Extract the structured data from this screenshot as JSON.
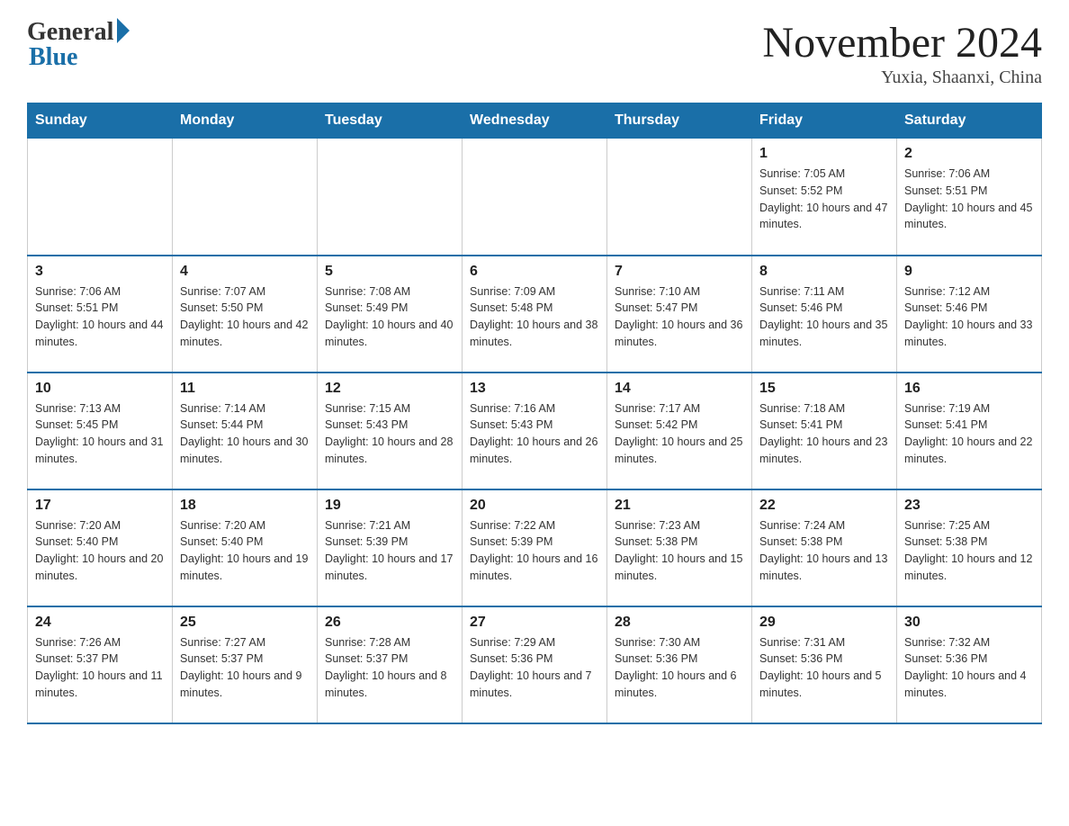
{
  "logo": {
    "general": "General",
    "blue": "Blue"
  },
  "title": {
    "month_year": "November 2024",
    "location": "Yuxia, Shaanxi, China"
  },
  "days_of_week": [
    "Sunday",
    "Monday",
    "Tuesday",
    "Wednesday",
    "Thursday",
    "Friday",
    "Saturday"
  ],
  "weeks": [
    [
      {
        "day": "",
        "info": ""
      },
      {
        "day": "",
        "info": ""
      },
      {
        "day": "",
        "info": ""
      },
      {
        "day": "",
        "info": ""
      },
      {
        "day": "",
        "info": ""
      },
      {
        "day": "1",
        "info": "Sunrise: 7:05 AM\nSunset: 5:52 PM\nDaylight: 10 hours and 47 minutes."
      },
      {
        "day": "2",
        "info": "Sunrise: 7:06 AM\nSunset: 5:51 PM\nDaylight: 10 hours and 45 minutes."
      }
    ],
    [
      {
        "day": "3",
        "info": "Sunrise: 7:06 AM\nSunset: 5:51 PM\nDaylight: 10 hours and 44 minutes."
      },
      {
        "day": "4",
        "info": "Sunrise: 7:07 AM\nSunset: 5:50 PM\nDaylight: 10 hours and 42 minutes."
      },
      {
        "day": "5",
        "info": "Sunrise: 7:08 AM\nSunset: 5:49 PM\nDaylight: 10 hours and 40 minutes."
      },
      {
        "day": "6",
        "info": "Sunrise: 7:09 AM\nSunset: 5:48 PM\nDaylight: 10 hours and 38 minutes."
      },
      {
        "day": "7",
        "info": "Sunrise: 7:10 AM\nSunset: 5:47 PM\nDaylight: 10 hours and 36 minutes."
      },
      {
        "day": "8",
        "info": "Sunrise: 7:11 AM\nSunset: 5:46 PM\nDaylight: 10 hours and 35 minutes."
      },
      {
        "day": "9",
        "info": "Sunrise: 7:12 AM\nSunset: 5:46 PM\nDaylight: 10 hours and 33 minutes."
      }
    ],
    [
      {
        "day": "10",
        "info": "Sunrise: 7:13 AM\nSunset: 5:45 PM\nDaylight: 10 hours and 31 minutes."
      },
      {
        "day": "11",
        "info": "Sunrise: 7:14 AM\nSunset: 5:44 PM\nDaylight: 10 hours and 30 minutes."
      },
      {
        "day": "12",
        "info": "Sunrise: 7:15 AM\nSunset: 5:43 PM\nDaylight: 10 hours and 28 minutes."
      },
      {
        "day": "13",
        "info": "Sunrise: 7:16 AM\nSunset: 5:43 PM\nDaylight: 10 hours and 26 minutes."
      },
      {
        "day": "14",
        "info": "Sunrise: 7:17 AM\nSunset: 5:42 PM\nDaylight: 10 hours and 25 minutes."
      },
      {
        "day": "15",
        "info": "Sunrise: 7:18 AM\nSunset: 5:41 PM\nDaylight: 10 hours and 23 minutes."
      },
      {
        "day": "16",
        "info": "Sunrise: 7:19 AM\nSunset: 5:41 PM\nDaylight: 10 hours and 22 minutes."
      }
    ],
    [
      {
        "day": "17",
        "info": "Sunrise: 7:20 AM\nSunset: 5:40 PM\nDaylight: 10 hours and 20 minutes."
      },
      {
        "day": "18",
        "info": "Sunrise: 7:20 AM\nSunset: 5:40 PM\nDaylight: 10 hours and 19 minutes."
      },
      {
        "day": "19",
        "info": "Sunrise: 7:21 AM\nSunset: 5:39 PM\nDaylight: 10 hours and 17 minutes."
      },
      {
        "day": "20",
        "info": "Sunrise: 7:22 AM\nSunset: 5:39 PM\nDaylight: 10 hours and 16 minutes."
      },
      {
        "day": "21",
        "info": "Sunrise: 7:23 AM\nSunset: 5:38 PM\nDaylight: 10 hours and 15 minutes."
      },
      {
        "day": "22",
        "info": "Sunrise: 7:24 AM\nSunset: 5:38 PM\nDaylight: 10 hours and 13 minutes."
      },
      {
        "day": "23",
        "info": "Sunrise: 7:25 AM\nSunset: 5:38 PM\nDaylight: 10 hours and 12 minutes."
      }
    ],
    [
      {
        "day": "24",
        "info": "Sunrise: 7:26 AM\nSunset: 5:37 PM\nDaylight: 10 hours and 11 minutes."
      },
      {
        "day": "25",
        "info": "Sunrise: 7:27 AM\nSunset: 5:37 PM\nDaylight: 10 hours and 9 minutes."
      },
      {
        "day": "26",
        "info": "Sunrise: 7:28 AM\nSunset: 5:37 PM\nDaylight: 10 hours and 8 minutes."
      },
      {
        "day": "27",
        "info": "Sunrise: 7:29 AM\nSunset: 5:36 PM\nDaylight: 10 hours and 7 minutes."
      },
      {
        "day": "28",
        "info": "Sunrise: 7:30 AM\nSunset: 5:36 PM\nDaylight: 10 hours and 6 minutes."
      },
      {
        "day": "29",
        "info": "Sunrise: 7:31 AM\nSunset: 5:36 PM\nDaylight: 10 hours and 5 minutes."
      },
      {
        "day": "30",
        "info": "Sunrise: 7:32 AM\nSunset: 5:36 PM\nDaylight: 10 hours and 4 minutes."
      }
    ]
  ]
}
